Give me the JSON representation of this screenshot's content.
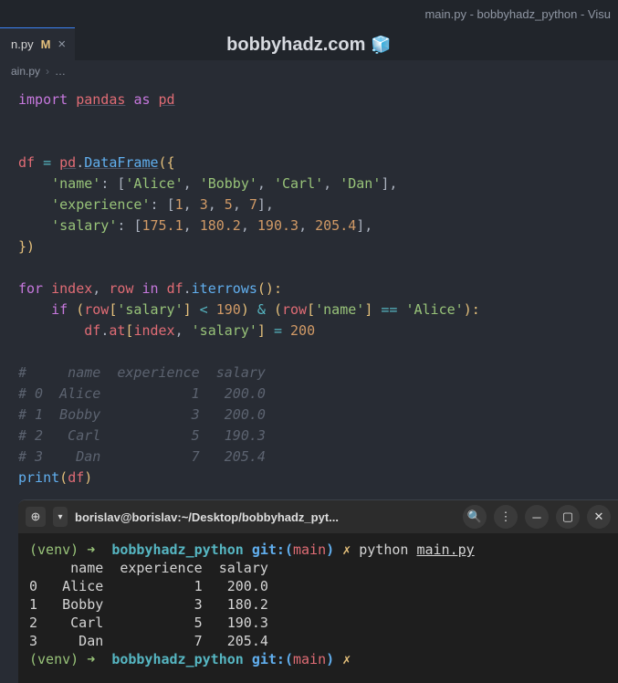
{
  "window": {
    "title": "main.py - bobbyhadz_python - Visu"
  },
  "watermark": {
    "text": "bobbyhadz.com",
    "icon": "🧊"
  },
  "tab": {
    "filename": "n.py",
    "modified_badge": "M",
    "close": "×"
  },
  "breadcrumb": {
    "file": "ain.py",
    "sep": "›",
    "more": "…"
  },
  "code": {
    "l1": {
      "import": "import",
      "pandas": "pandas",
      "as": "as",
      "pd": "pd"
    },
    "l4": {
      "df": "df",
      "eq": "=",
      "pd": "pd",
      "dot": ".",
      "DataFrame": "DataFrame",
      "open": "({"
    },
    "l5": {
      "indent": "    ",
      "k": "'name'",
      "colon": ": ",
      "open": "[",
      "v1": "'Alice'",
      "c": ", ",
      "v2": "'Bobby'",
      "v3": "'Carl'",
      "v4": "'Dan'",
      "close": "],"
    },
    "l6": {
      "indent": "    ",
      "k": "'experience'",
      "colon": ": ",
      "open": "[",
      "v1": "1",
      "c": ", ",
      "v2": "3",
      "v3": "5",
      "v4": "7",
      "close": "],"
    },
    "l7": {
      "indent": "    ",
      "k": "'salary'",
      "colon": ": ",
      "open": "[",
      "v1": "175.1",
      "c": ", ",
      "v2": "180.2",
      "v3": "190.3",
      "v4": "205.4",
      "close": "],"
    },
    "l8": {
      "close": "})"
    },
    "l10": {
      "for": "for",
      "index": "index",
      "c1": ", ",
      "row": "row",
      "in": "in",
      "df": "df",
      "dot": ".",
      "iterrows": "iterrows",
      "paren": "():",
      "colon": ""
    },
    "l11": {
      "indent": "    ",
      "if": "if",
      "sp": " ",
      "open": "(",
      "row": "row",
      "b1": "[",
      "salary": "'salary'",
      "b2": "]",
      "lt": " < ",
      "n190": "190",
      "close": ")",
      "amp": " & ",
      "open2": "(",
      "row2": "row",
      "b3": "[",
      "name": "'name'",
      "b4": "]",
      "eq": " == ",
      "alice": "'Alice'",
      "close2": "):"
    },
    "l12": {
      "indent": "        ",
      "df": "df",
      "dot": ".",
      "at": "at",
      "b1": "[",
      "index": "index",
      "c": ", ",
      "salary": "'salary'",
      "b2": "]",
      "eq": " = ",
      "n200": "200"
    },
    "l14": "#     name  experience  salary",
    "l15": "# 0  Alice           1   200.0",
    "l16": "# 1  Bobby           3   200.0",
    "l17": "# 2   Carl           5   190.3",
    "l18": "# 3    Dan           7   205.4",
    "l19": {
      "print": "print",
      "open": "(",
      "df": "df",
      "close": ")"
    }
  },
  "terminal": {
    "title": "borislav@borislav:~/Desktop/bobbyhadz_pyt...",
    "p1": {
      "venv": "(venv)",
      "arrow": " ➜  ",
      "dir": "bobbyhadz_python",
      "gitpre": " git:(",
      "branch": "main",
      "gitpost": ") ",
      "dirty": "✗",
      "cmd": " python ",
      "file": "main.py"
    },
    "out": "     name  experience  salary\n0   Alice           1   200.0\n1   Bobby           3   180.2\n2    Carl           5   190.3\n3     Dan           7   205.4",
    "p2": {
      "venv": "(venv)",
      "arrow": " ➜  ",
      "dir": "bobbyhadz_python",
      "gitpre": " git:(",
      "branch": "main",
      "gitpost": ") ",
      "dirty": "✗"
    }
  },
  "chart_data": {
    "type": "table",
    "columns": [
      "name",
      "experience",
      "salary"
    ],
    "rows": [
      [
        "Alice",
        1,
        200.0
      ],
      [
        "Bobby",
        3,
        180.2
      ],
      [
        "Carl",
        5,
        190.3
      ],
      [
        "Dan",
        7,
        205.4
      ]
    ]
  }
}
